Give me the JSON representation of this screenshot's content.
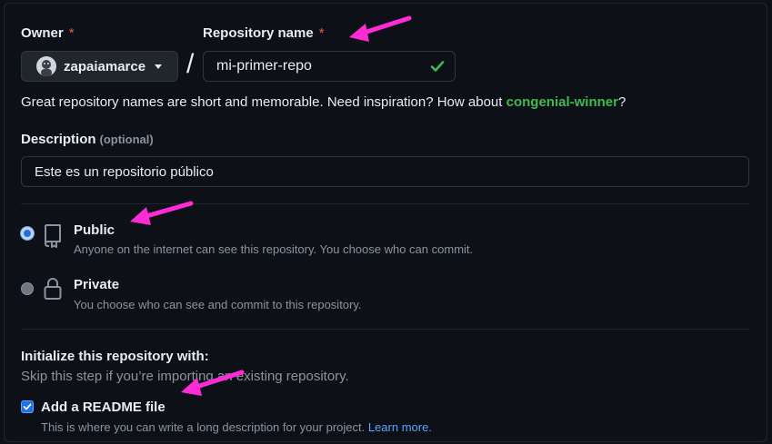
{
  "owner": {
    "label": "Owner",
    "required_mark": "*",
    "value": "zapaiamarce"
  },
  "repo": {
    "label": "Repository name",
    "required_mark": "*",
    "value": "mi-primer-repo",
    "separator": "/"
  },
  "hint": {
    "text": "Great repository names are short and memorable. Need inspiration? How about ",
    "suggestion": "congenial-winner",
    "end": "?"
  },
  "description": {
    "label": "Description",
    "optional": "(optional)",
    "value": "Este es un repositorio público"
  },
  "visibility": {
    "selected": "public",
    "public": {
      "title": "Public",
      "subtitle": "Anyone on the internet can see this repository. You choose who can commit."
    },
    "private": {
      "title": "Private",
      "subtitle": "You choose who can see and commit to this repository."
    }
  },
  "initialize": {
    "title": "Initialize this repository with:",
    "subtitle": "Skip this step if you’re importing an existing repository.",
    "readme_label": "Add a README file",
    "readme_checked": true,
    "readme_sub": "This is where you can write a long description for your project. ",
    "learn_more": "Learn more."
  },
  "colors": {
    "background": "#0d1117",
    "accent_green": "#3fb950",
    "link_blue": "#58a6ff",
    "annotation_arrow": "#ff2bd6"
  }
}
